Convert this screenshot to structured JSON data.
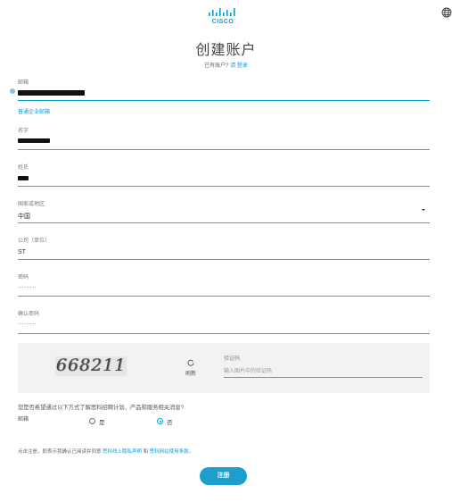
{
  "brand": {
    "logo_text": "CISCO",
    "accent_color": "#049fd9",
    "button_color": "#1d9fcd"
  },
  "header": {
    "language_icon": "globe-icon"
  },
  "page": {
    "title": "创建账户",
    "have_account_text": "已有账户?",
    "login_link": "请 登录"
  },
  "form": {
    "email": {
      "label": "邮箱",
      "value_redacted": true,
      "alt_link": "普通企业邮箱"
    },
    "first_name": {
      "label": "名字",
      "value_redacted": true
    },
    "last_name": {
      "label": "姓氏",
      "value_redacted": true
    },
    "country": {
      "label": "国家或地区",
      "value": "中国"
    },
    "company": {
      "label": "公司（单位）",
      "value": "ST"
    },
    "password": {
      "label": "密码",
      "value": "·········"
    },
    "confirm_password": {
      "label": "确认密码",
      "value": "·········"
    },
    "captcha": {
      "image_text": "668211",
      "refresh_label": "刷新",
      "input_label": "验证码",
      "input_placeholder": "输入图片中的验证码"
    },
    "marketing": {
      "question": "您是否希望通过以下方式了解思科招聘计划、产品和服务相关消息?",
      "channel_label": "邮箱",
      "options": [
        "是",
        "否"
      ],
      "selected": "否"
    },
    "terms": {
      "prefix": "点击注册，即表示我确认已阅读并同意",
      "privacy_link": "思科线上隐私声明",
      "conjunction": "和",
      "terms_link": "思科网站使用条款",
      "suffix": "。"
    },
    "submit_label": "注册"
  }
}
